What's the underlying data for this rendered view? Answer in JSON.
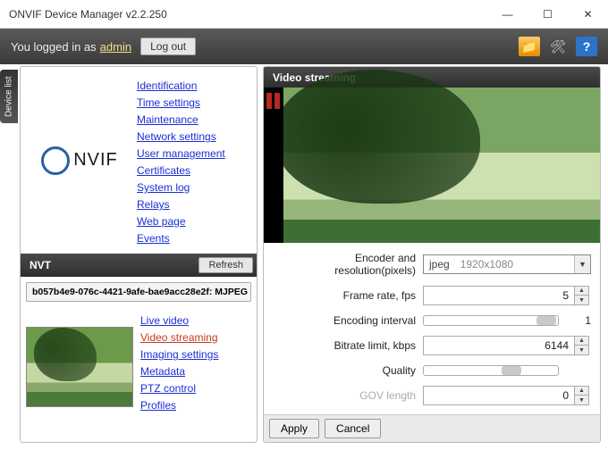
{
  "window": {
    "title": "ONVIF Device Manager v2.2.250"
  },
  "toolbar": {
    "logged_in_prefix": "You logged in as",
    "user": "admin",
    "logout": "Log out"
  },
  "side_tab": "Device list",
  "left": {
    "logo_text": "NVIF",
    "top_links": [
      "Identification",
      "Time settings",
      "Maintenance",
      "Network settings",
      "User management",
      "Certificates",
      "System log",
      "Relays",
      "Web page",
      "Events"
    ],
    "nvt_label": "NVT",
    "refresh": "Refresh",
    "device_id": "b057b4e9-076c-4421-9afe-bae9acc28e2f: MJPEG",
    "bottom_links": [
      "Live video",
      "Video streaming",
      "Imaging settings",
      "Metadata",
      "PTZ control",
      "Profiles"
    ],
    "active_bottom_index": 1
  },
  "right": {
    "header": "Video streaming",
    "fields": {
      "encoder_label": "Encoder and resolution(pixels)",
      "encoder_codec": "jpeg",
      "encoder_res": "1920x1080",
      "framerate_label": "Frame rate, fps",
      "framerate_value": "5",
      "encint_label": "Encoding interval",
      "encint_value": "1",
      "bitrate_label": "Bitrate limit, kbps",
      "bitrate_value": "6144",
      "quality_label": "Quality",
      "gov_label": "GOV length",
      "gov_value": "0"
    },
    "apply": "Apply",
    "cancel": "Cancel"
  }
}
